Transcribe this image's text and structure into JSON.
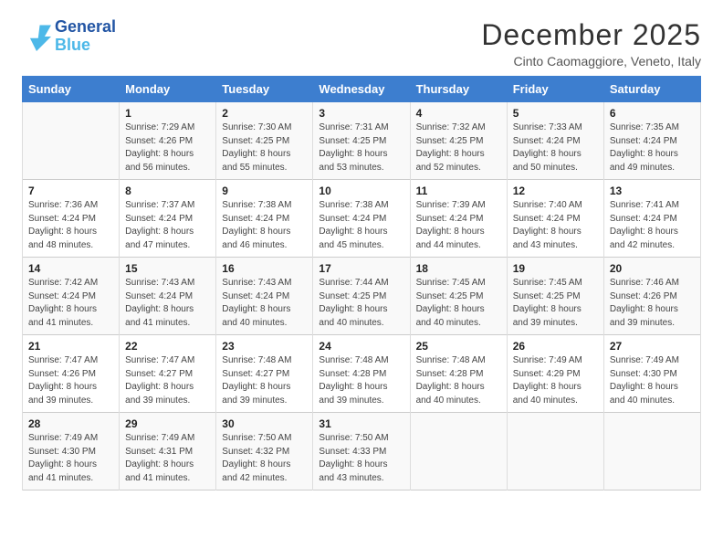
{
  "logo": {
    "line1": "General",
    "line2": "Blue"
  },
  "title": "December 2025",
  "subtitle": "Cinto Caomaggiore, Veneto, Italy",
  "days_header": [
    "Sunday",
    "Monday",
    "Tuesday",
    "Wednesday",
    "Thursday",
    "Friday",
    "Saturday"
  ],
  "weeks": [
    [
      {
        "day": "",
        "info": ""
      },
      {
        "day": "1",
        "info": "Sunrise: 7:29 AM\nSunset: 4:26 PM\nDaylight: 8 hours\nand 56 minutes."
      },
      {
        "day": "2",
        "info": "Sunrise: 7:30 AM\nSunset: 4:25 PM\nDaylight: 8 hours\nand 55 minutes."
      },
      {
        "day": "3",
        "info": "Sunrise: 7:31 AM\nSunset: 4:25 PM\nDaylight: 8 hours\nand 53 minutes."
      },
      {
        "day": "4",
        "info": "Sunrise: 7:32 AM\nSunset: 4:25 PM\nDaylight: 8 hours\nand 52 minutes."
      },
      {
        "day": "5",
        "info": "Sunrise: 7:33 AM\nSunset: 4:24 PM\nDaylight: 8 hours\nand 50 minutes."
      },
      {
        "day": "6",
        "info": "Sunrise: 7:35 AM\nSunset: 4:24 PM\nDaylight: 8 hours\nand 49 minutes."
      }
    ],
    [
      {
        "day": "7",
        "info": "Sunrise: 7:36 AM\nSunset: 4:24 PM\nDaylight: 8 hours\nand 48 minutes."
      },
      {
        "day": "8",
        "info": "Sunrise: 7:37 AM\nSunset: 4:24 PM\nDaylight: 8 hours\nand 47 minutes."
      },
      {
        "day": "9",
        "info": "Sunrise: 7:38 AM\nSunset: 4:24 PM\nDaylight: 8 hours\nand 46 minutes."
      },
      {
        "day": "10",
        "info": "Sunrise: 7:38 AM\nSunset: 4:24 PM\nDaylight: 8 hours\nand 45 minutes."
      },
      {
        "day": "11",
        "info": "Sunrise: 7:39 AM\nSunset: 4:24 PM\nDaylight: 8 hours\nand 44 minutes."
      },
      {
        "day": "12",
        "info": "Sunrise: 7:40 AM\nSunset: 4:24 PM\nDaylight: 8 hours\nand 43 minutes."
      },
      {
        "day": "13",
        "info": "Sunrise: 7:41 AM\nSunset: 4:24 PM\nDaylight: 8 hours\nand 42 minutes."
      }
    ],
    [
      {
        "day": "14",
        "info": "Sunrise: 7:42 AM\nSunset: 4:24 PM\nDaylight: 8 hours\nand 41 minutes."
      },
      {
        "day": "15",
        "info": "Sunrise: 7:43 AM\nSunset: 4:24 PM\nDaylight: 8 hours\nand 41 minutes."
      },
      {
        "day": "16",
        "info": "Sunrise: 7:43 AM\nSunset: 4:24 PM\nDaylight: 8 hours\nand 40 minutes."
      },
      {
        "day": "17",
        "info": "Sunrise: 7:44 AM\nSunset: 4:25 PM\nDaylight: 8 hours\nand 40 minutes."
      },
      {
        "day": "18",
        "info": "Sunrise: 7:45 AM\nSunset: 4:25 PM\nDaylight: 8 hours\nand 40 minutes."
      },
      {
        "day": "19",
        "info": "Sunrise: 7:45 AM\nSunset: 4:25 PM\nDaylight: 8 hours\nand 39 minutes."
      },
      {
        "day": "20",
        "info": "Sunrise: 7:46 AM\nSunset: 4:26 PM\nDaylight: 8 hours\nand 39 minutes."
      }
    ],
    [
      {
        "day": "21",
        "info": "Sunrise: 7:47 AM\nSunset: 4:26 PM\nDaylight: 8 hours\nand 39 minutes."
      },
      {
        "day": "22",
        "info": "Sunrise: 7:47 AM\nSunset: 4:27 PM\nDaylight: 8 hours\nand 39 minutes."
      },
      {
        "day": "23",
        "info": "Sunrise: 7:48 AM\nSunset: 4:27 PM\nDaylight: 8 hours\nand 39 minutes."
      },
      {
        "day": "24",
        "info": "Sunrise: 7:48 AM\nSunset: 4:28 PM\nDaylight: 8 hours\nand 39 minutes."
      },
      {
        "day": "25",
        "info": "Sunrise: 7:48 AM\nSunset: 4:28 PM\nDaylight: 8 hours\nand 40 minutes."
      },
      {
        "day": "26",
        "info": "Sunrise: 7:49 AM\nSunset: 4:29 PM\nDaylight: 8 hours\nand 40 minutes."
      },
      {
        "day": "27",
        "info": "Sunrise: 7:49 AM\nSunset: 4:30 PM\nDaylight: 8 hours\nand 40 minutes."
      }
    ],
    [
      {
        "day": "28",
        "info": "Sunrise: 7:49 AM\nSunset: 4:30 PM\nDaylight: 8 hours\nand 41 minutes."
      },
      {
        "day": "29",
        "info": "Sunrise: 7:49 AM\nSunset: 4:31 PM\nDaylight: 8 hours\nand 41 minutes."
      },
      {
        "day": "30",
        "info": "Sunrise: 7:50 AM\nSunset: 4:32 PM\nDaylight: 8 hours\nand 42 minutes."
      },
      {
        "day": "31",
        "info": "Sunrise: 7:50 AM\nSunset: 4:33 PM\nDaylight: 8 hours\nand 43 minutes."
      },
      {
        "day": "",
        "info": ""
      },
      {
        "day": "",
        "info": ""
      },
      {
        "day": "",
        "info": ""
      }
    ]
  ]
}
